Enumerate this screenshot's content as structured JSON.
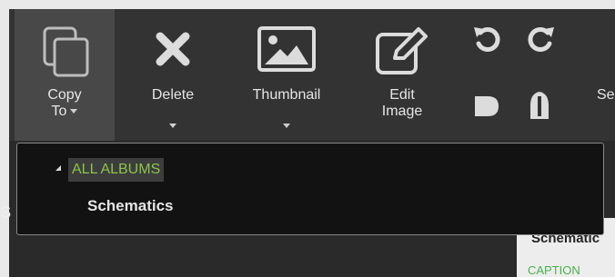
{
  "toolbar": {
    "copy_to": {
      "line1": "Copy",
      "line2": "To",
      "icon": "copy-icon"
    },
    "delete": {
      "label": "Delete",
      "icon": "close-x-icon"
    },
    "thumbnail": {
      "label": "Thumbnail",
      "icon": "image-icon"
    },
    "edit_image": {
      "line1": "Edit",
      "line2": "Image",
      "icon": "edit-image-icon"
    },
    "rotate_left": {
      "icon": "rotate-left-icon"
    },
    "rotate_right": {
      "icon": "rotate-right-icon"
    },
    "flip_h": {
      "icon": "tag-flip-icon"
    },
    "flip_v": {
      "icon": "shape-flip-icon"
    },
    "next_label_partial": "Se"
  },
  "dropdown": {
    "tree_root": "ALL ALBUMS",
    "tree_child": "Schematics"
  },
  "background": {
    "left_partial": "S",
    "right_panel_title_partial": "Schematic",
    "right_panel_caption_partial": "CAPTION"
  },
  "colors": {
    "toolbar_bg": "#333333",
    "active_tool_bg": "#484848",
    "dropdown_bg": "#121212",
    "tree_root_text": "#8bc34a"
  }
}
